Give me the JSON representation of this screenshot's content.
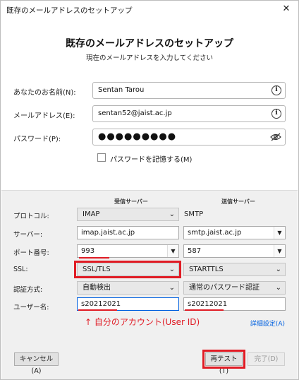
{
  "window": {
    "title": "既存のメールアドレスのセットアップ",
    "close_glyph": "✕"
  },
  "header": {
    "heading": "既存のメールアドレスのセットアップ",
    "subheading": "現在のメールアドレスを入力してください"
  },
  "account_form": {
    "name_label": "あなたのお名前(N):",
    "name_value": "Sentan Tarou",
    "email_label": "メールアドレス(E):",
    "email_value": "sentan52@jaist.ac.jp",
    "password_label": "パスワード(P):",
    "password_value": "●●●●●●●●●",
    "remember_label": "パスワードを記憶する(M)",
    "info_icon": "info-icon",
    "eye_icon": "eye-off-icon"
  },
  "server_config": {
    "incoming_header": "受信サーバー",
    "outgoing_header": "送信サーバー",
    "protocol_label": "プロトコル:",
    "incoming_protocol": "IMAP",
    "outgoing_protocol": "SMTP",
    "server_label": "サーバー:",
    "incoming_server": "imap.jaist.ac.jp",
    "outgoing_server": "smtp.jaist.ac.jp",
    "port_label": "ポート番号:",
    "incoming_port": "993",
    "outgoing_port": "587",
    "ssl_label": "SSL:",
    "incoming_ssl": "SSL/TLS",
    "outgoing_ssl": "STARTTLS",
    "auth_label": "認証方式:",
    "incoming_auth": "自動検出",
    "outgoing_auth": "通常のパスワード認証",
    "username_label": "ユーザー名:",
    "incoming_username": "s20212021",
    "outgoing_username": "s20212021"
  },
  "annotation": {
    "text": "↑ 自分のアカウント(User ID)",
    "color": "#e01b24"
  },
  "advanced_link": "詳細設定(A)",
  "footer": {
    "cancel_label": "キャンセル(A)",
    "retest_label": "再テスト(T)",
    "done_label": "完了(D)"
  }
}
